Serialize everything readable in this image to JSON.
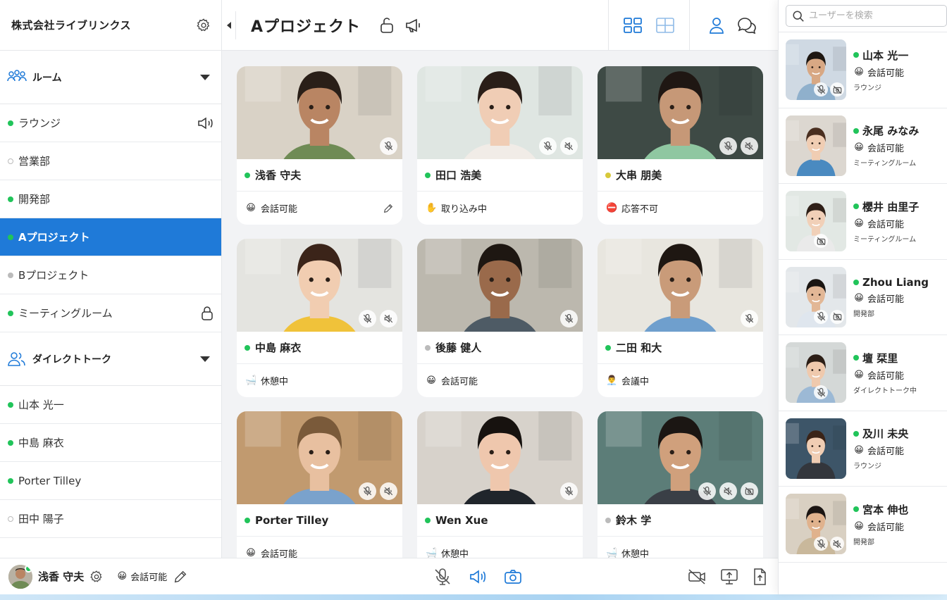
{
  "org": {
    "name": "株式会社ライブリンクス"
  },
  "sidebar": {
    "rooms_header": "ルーム",
    "rooms": [
      {
        "label": "ラウンジ",
        "status": "green",
        "icon": "speaker-icon"
      },
      {
        "label": "営業部",
        "status": "empty"
      },
      {
        "label": "開発部",
        "status": "green"
      },
      {
        "label": "Aプロジェクト",
        "status": "green",
        "active": true
      },
      {
        "label": "Bプロジェクト",
        "status": "gray"
      },
      {
        "label": "ミーティングルーム",
        "status": "green",
        "icon": "lock-icon"
      }
    ],
    "direct_header": "ダイレクトトーク",
    "directs": [
      {
        "label": "山本 光一",
        "status": "green"
      },
      {
        "label": "中島 麻衣",
        "status": "green"
      },
      {
        "label": "Porter Tilley",
        "status": "green"
      },
      {
        "label": "田中 陽子",
        "status": "empty"
      }
    ]
  },
  "topbar": {
    "room_title": "Aプロジェクト"
  },
  "cards": [
    {
      "name": "浅香 守夫",
      "presence": "green",
      "status_emoji": "😀",
      "status": "会話可能",
      "editable": true,
      "bg": "#d9d2c6",
      "skin": "#b98563",
      "shirt": "#6f8b55",
      "hair": "#2a1f18",
      "icons": [
        "mic-off"
      ]
    },
    {
      "name": "田口 浩美",
      "presence": "green",
      "status_emoji": "✋",
      "status": "取り込み中",
      "bg": "#dfe6e2",
      "skin": "#f0cdb5",
      "shirt": "#f1ece7",
      "hair": "#2a1e18",
      "icons": [
        "mic-off",
        "speaker-off"
      ]
    },
    {
      "name": "大串 朋美",
      "presence": "yellow",
      "status_emoji": "⛔",
      "status": "応答不可",
      "bg": "#3e4a45",
      "skin": "#c69877",
      "shirt": "#8fc7a1",
      "hair": "#1f1713",
      "icons": [
        "mic-off",
        "speaker-off"
      ]
    },
    {
      "name": "中島 麻衣",
      "presence": "green",
      "status_emoji": "🛁",
      "status": "休憩中",
      "bg": "#e4e4e0",
      "skin": "#f1cdb1",
      "shirt": "#f0c23a",
      "hair": "#3b2419",
      "icons": [
        "mic-off",
        "speaker-off"
      ]
    },
    {
      "name": "後藤 健人",
      "presence": "gray",
      "status_emoji": "😀",
      "status": "会話可能",
      "bg": "#bcb8ae",
      "skin": "#9a6a4b",
      "shirt": "#4e5b65",
      "hair": "#1e1712",
      "icons": [
        "mic-off"
      ]
    },
    {
      "name": "二田 和大",
      "presence": "green",
      "status_emoji": "👨‍💼",
      "status": "会議中",
      "bg": "#e8e6df",
      "skin": "#c99b79",
      "shirt": "#6f9fcd",
      "hair": "#1e1712",
      "icons": [
        "mic-off"
      ]
    },
    {
      "name": "Porter Tilley",
      "presence": "green",
      "status_emoji": "😀",
      "status": "会話可能",
      "bg": "#c19a6f",
      "skin": "#e8c0a0",
      "shirt": "#7aa2cc",
      "hair": "#7a5a3a",
      "icons": [
        "mic-off",
        "speaker-off"
      ]
    },
    {
      "name": "Wen Xue",
      "presence": "green",
      "status_emoji": "🛁",
      "status": "休憩中",
      "bg": "#d7d2cb",
      "skin": "#efc7ad",
      "shirt": "#20252b",
      "hair": "#17120f",
      "icons": [
        "mic-off"
      ]
    },
    {
      "name": "鈴木 学",
      "presence": "gray",
      "status_emoji": "🛁",
      "status": "休憩中",
      "bg": "#5c7d78",
      "skin": "#d0a07c",
      "shirt": "#3a3f46",
      "hair": "#1b1613",
      "icons": [
        "mic-off",
        "speaker-off",
        "camera-off"
      ]
    }
  ],
  "bottombar": {
    "me_name": "浅香 守夫",
    "me_status_emoji": "😀",
    "me_status": "会話可能"
  },
  "userpanel": {
    "search_placeholder": "ユーザーを検索",
    "users": [
      {
        "name": "山本 光一",
        "status_emoji": "😀",
        "status": "会話可能",
        "room": "ラウンジ",
        "bg": "#cfd9e3",
        "skin": "#d8a884",
        "shirt": "#8fb0cc",
        "hair": "#1e1712",
        "icons": [
          "mic-off",
          "camera-off"
        ]
      },
      {
        "name": "永尾 みなみ",
        "status_emoji": "😀",
        "status": "会話可能",
        "room": "ミーティングルーム",
        "bg": "#dcd7d0",
        "skin": "#f0cdb3",
        "shirt": "#4a8ac0",
        "hair": "#4a2f20",
        "icons": []
      },
      {
        "name": "櫻井 由里子",
        "status_emoji": "😀",
        "status": "会話可能",
        "room": "ミーティングルーム",
        "bg": "#e2e8e4",
        "skin": "#f1d0b8",
        "shirt": "#eaeaea",
        "hair": "#2e1f17",
        "icons": [
          "camera-off"
        ]
      },
      {
        "name": "Zhou Liang",
        "status_emoji": "😀",
        "status": "会話可能",
        "room": "開発部",
        "bg": "#e3e7ea",
        "skin": "#e2b796",
        "shirt": "#dfe6ee",
        "hair": "#1a1512",
        "icons": [
          "mic-off",
          "camera-off"
        ]
      },
      {
        "name": "壇 栞里",
        "status_emoji": "😀",
        "status": "会話可能",
        "room": "ダイレクトトーク中",
        "bg": "#d4d8d7",
        "skin": "#efc9ad",
        "shirt": "#9cb9d5",
        "hair": "#2c1e16",
        "icons": [
          "mic-off"
        ]
      },
      {
        "name": "及川 未央",
        "status_emoji": "😀",
        "status": "会話可能",
        "room": "ラウンジ",
        "bg": "#3d5568",
        "skin": "#f0cdb3",
        "shirt": "#33363c",
        "hair": "#3a2418",
        "icons": []
      },
      {
        "name": "宮本 伸也",
        "status_emoji": "😀",
        "status": "会話可能",
        "room": "開発部",
        "bg": "#d9d0c2",
        "skin": "#e0b28d",
        "shirt": "#c9b89b",
        "hair": "#1b1512",
        "icons": [
          "mic-off",
          "speaker-off"
        ]
      }
    ]
  },
  "colors": {
    "accent": "#1f7ad8",
    "online": "#21c45a",
    "away": "#d7c93a"
  }
}
